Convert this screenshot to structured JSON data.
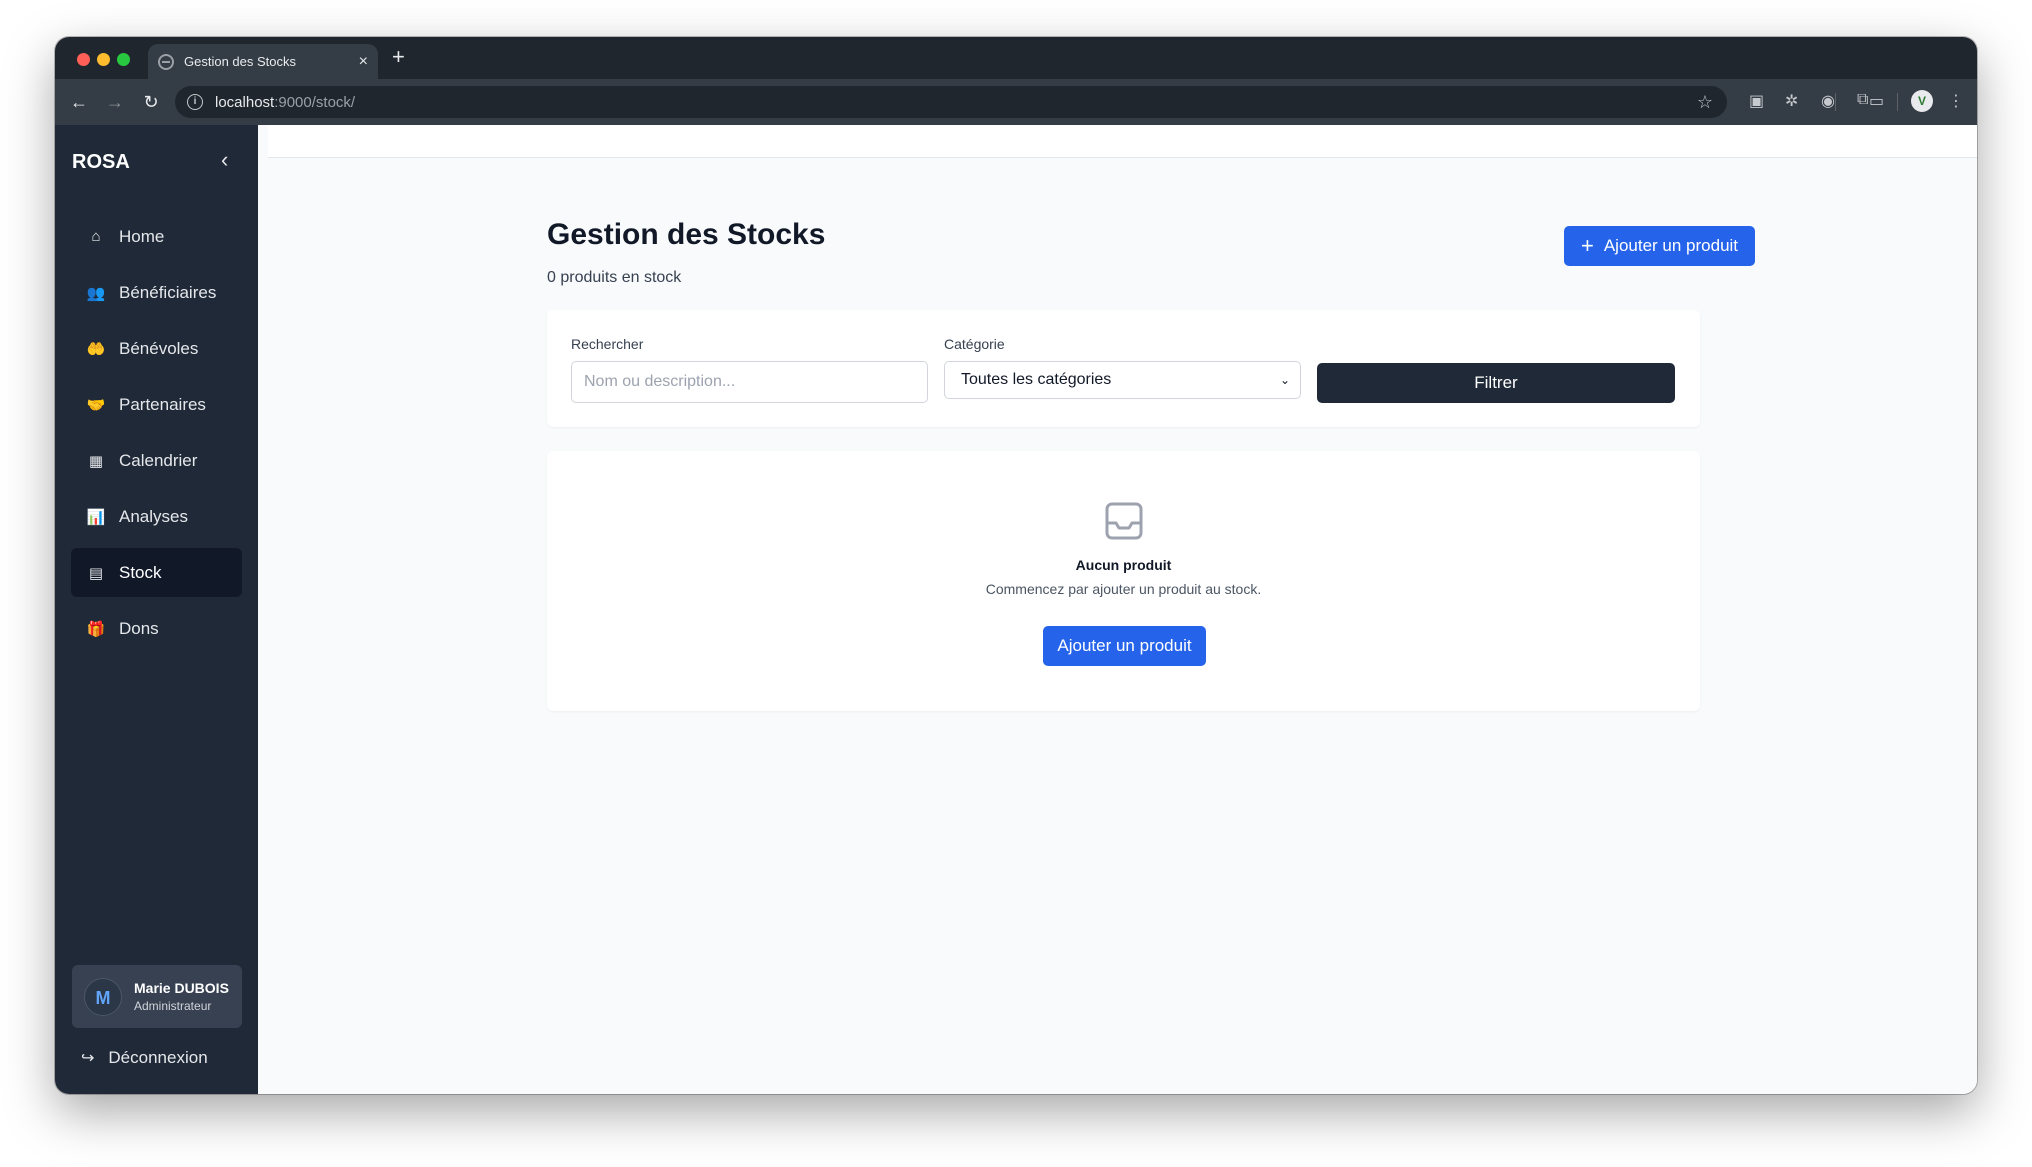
{
  "browser": {
    "tab_title": "Gestion des Stocks",
    "tab_close": "×",
    "new_tab": "+",
    "url_host": "localhost",
    "url_path": ":9000/stock/",
    "back": "←",
    "forward": "→",
    "reload": "↻",
    "star": "☆",
    "profile_initial": "V"
  },
  "sidebar": {
    "brand": "ROSA",
    "collapse": "‹",
    "items": [
      {
        "label": "Home",
        "icon": "⌂"
      },
      {
        "label": "Bénéficiaires",
        "icon": "👥"
      },
      {
        "label": "Bénévoles",
        "icon": "🤲"
      },
      {
        "label": "Partenaires",
        "icon": "🤝"
      },
      {
        "label": "Calendrier",
        "icon": "▦"
      },
      {
        "label": "Analyses",
        "icon": "📊"
      },
      {
        "label": "Stock",
        "icon": "▤"
      },
      {
        "label": "Dons",
        "icon": "🎁"
      }
    ],
    "active_item": "Stock",
    "user": {
      "initial": "M",
      "name": "Marie DUBOIS",
      "role": "Administrateur"
    },
    "logout": {
      "label": "Déconnexion",
      "icon": "↪"
    }
  },
  "main": {
    "title": "Gestion des Stocks",
    "subtitle": "0 produits en stock",
    "add_button": "Ajouter un produit",
    "add_icon": "+",
    "filters": {
      "search_label": "Rechercher",
      "search_placeholder": "Nom ou description...",
      "search_value": "",
      "category_label": "Catégorie",
      "category_value": "Toutes les catégories",
      "filter_button": "Filtrer"
    },
    "empty": {
      "title": "Aucun produit",
      "text": "Commencez par ajouter un produit au stock.",
      "button": "Ajouter un produit"
    }
  },
  "colors": {
    "sidebar_bg": "#1f2937",
    "primary": "#2563eb",
    "dark_button": "#1f2937",
    "page_bg": "#f9fafb"
  }
}
